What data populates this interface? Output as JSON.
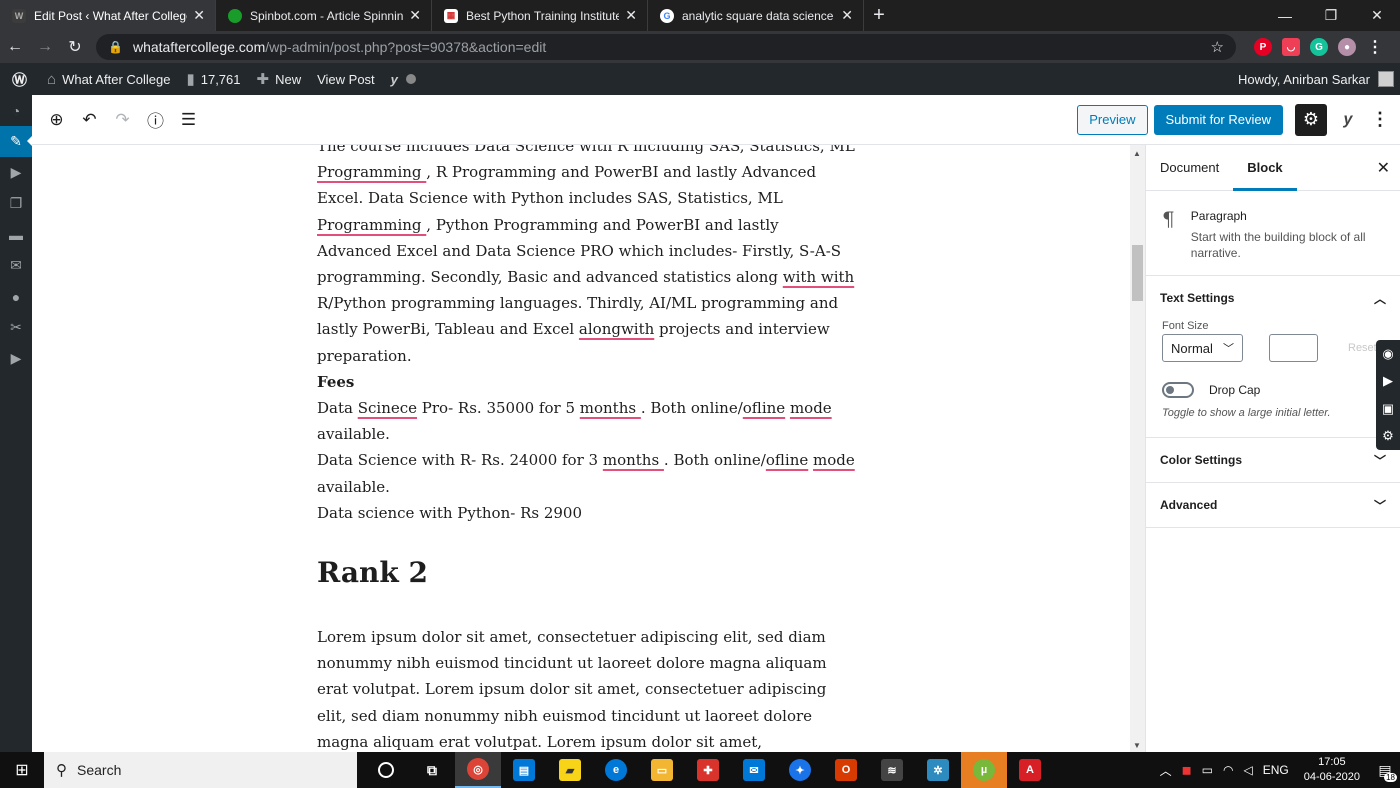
{
  "browser": {
    "tabs": [
      {
        "title": "Edit Post ‹ What After College —",
        "active": true,
        "favicon_color": "#3c3c3c"
      },
      {
        "title": "Spinbot.com - Article Spinning, Te",
        "active": false,
        "favicon_color": "#1a9c2a"
      },
      {
        "title": "Best Python Training Institute wit",
        "active": false,
        "favicon_color": "#d32f2f"
      },
      {
        "title": "analytic square data science fees",
        "active": false,
        "favicon_color": "#4285f4"
      }
    ],
    "url_host": "whataftercollege.com",
    "url_path": "/wp-admin/post.php?post=90378&action=edit"
  },
  "adminbar": {
    "site_name": "What After College",
    "comments_count": "17,761",
    "new_label": "New",
    "view_post_label": "View Post",
    "howdy": "Howdy, Anirban Sarkar"
  },
  "editor_header": {
    "preview_label": "Preview",
    "submit_label": "Submit for Review"
  },
  "content": {
    "p1_a": "The course includes Data Science with R including SAS, Statistics, ML ",
    "p1_b": "Programming ",
    "p1_c": ", R Programming and PowerBI and lastly Advanced Excel. Data Science with Python includes  SAS, Statistics, ML ",
    "p1_d": "Programming ",
    "p1_e": ", Python Programming and PowerBI and lastly Advanced Excel and Data Science PRO which includes- Firstly, S-A-S programming. Secondly, Basic and advanced statistics along ",
    "p1_f": "with with",
    "p1_g": " R/Python programming languages. Thirdly, AI/ML programming and lastly PowerBi, Tableau and Excel ",
    "p1_h": "alongwith",
    "p1_i": " projects and interview preparation.",
    "fees_heading": "Fees",
    "fee1_a": "Data ",
    "fee1_b": "Scinece",
    "fee1_c": " Pro- Rs. 35000 for 5 ",
    "fee1_d": "months ",
    "fee1_e": ". Both online/",
    "fee1_f": "ofline",
    "fee1_g": " ",
    "fee1_h": "mode",
    "fee1_i": " available.",
    "fee2_a": "Data Science with R- Rs. 24000 for 3 ",
    "fee2_b": "months ",
    "fee2_c": ".  Both online/",
    "fee2_d": "ofline",
    "fee2_e": " ",
    "fee2_f": "mode",
    "fee2_g": " available.",
    "fee3": "Data science with Python- Rs 2900",
    "rank_heading": "Rank 2",
    "lorem": "Lorem ipsum dolor sit amet, consectetuer adipiscing elit, sed diam nonummy nibh euismod tincidunt ut laoreet dolore magna aliquam erat volutpat. Lorem ipsum dolor sit amet, consectetuer adipiscing elit, sed diam nonummy nibh euismod tincidunt ut laoreet dolore magna aliquam erat volutpat. Lorem ipsum dolor sit amet, consectetuer adipiscing elit, sed diam nonummy nibh euismod tincidunt ut laoreet dolore magna aliquam erat"
  },
  "sidebar": {
    "tab_document": "Document",
    "tab_block": "Block",
    "block_title": "Paragraph",
    "block_desc": "Start with the building block of all narrative.",
    "text_settings": "Text Settings",
    "font_size_label": "Font Size",
    "font_size_value": "Normal",
    "reset_label": "Reset",
    "drop_cap_label": "Drop Cap",
    "drop_cap_help": "Toggle to show a large initial letter.",
    "color_settings": "Color Settings",
    "advanced": "Advanced"
  },
  "taskbar": {
    "search_label": "Search",
    "lang": "ENG",
    "time": "17:05",
    "date": "04-06-2020",
    "notif_count": "18"
  },
  "colors": {
    "wp_blue": "#007cba",
    "admin_dark": "#23282d",
    "spell_underline": "#e0507a"
  }
}
